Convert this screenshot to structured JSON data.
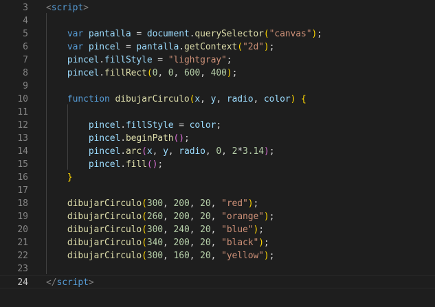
{
  "editor": {
    "line_numbers": [
      "3",
      "4",
      "5",
      "6",
      "7",
      "8",
      "9",
      "10",
      "11",
      "12",
      "13",
      "14",
      "15",
      "16",
      "17",
      "18",
      "19",
      "20",
      "21",
      "22",
      "23",
      "24"
    ],
    "active_line": "24",
    "lines": [
      {
        "segs": [
          {
            "t": "<",
            "c": "tagb"
          },
          {
            "t": "script",
            "c": "tag"
          },
          {
            "t": ">",
            "c": "tagb"
          }
        ]
      },
      {
        "segs": []
      },
      {
        "segs": [
          {
            "t": "    "
          },
          {
            "t": "var",
            "c": "kw"
          },
          {
            "t": " "
          },
          {
            "t": "pantalla",
            "c": "var"
          },
          {
            "t": " = "
          },
          {
            "t": "document",
            "c": "var"
          },
          {
            "t": "."
          },
          {
            "t": "querySelector",
            "c": "fn"
          },
          {
            "t": "(",
            "c": "p1"
          },
          {
            "t": "\"canvas\"",
            "c": "str"
          },
          {
            "t": ")",
            "c": "p1"
          },
          {
            "t": ";"
          }
        ]
      },
      {
        "segs": [
          {
            "t": "    "
          },
          {
            "t": "var",
            "c": "kw"
          },
          {
            "t": " "
          },
          {
            "t": "pincel",
            "c": "var"
          },
          {
            "t": " = "
          },
          {
            "t": "pantalla",
            "c": "var"
          },
          {
            "t": "."
          },
          {
            "t": "getContext",
            "c": "fn"
          },
          {
            "t": "(",
            "c": "p1"
          },
          {
            "t": "\"2d\"",
            "c": "str"
          },
          {
            "t": ")",
            "c": "p1"
          },
          {
            "t": ";"
          }
        ]
      },
      {
        "segs": [
          {
            "t": "    "
          },
          {
            "t": "pincel",
            "c": "var"
          },
          {
            "t": "."
          },
          {
            "t": "fillStyle",
            "c": "var"
          },
          {
            "t": " = "
          },
          {
            "t": "\"lightgray\"",
            "c": "str"
          },
          {
            "t": ";"
          }
        ]
      },
      {
        "segs": [
          {
            "t": "    "
          },
          {
            "t": "pincel",
            "c": "var"
          },
          {
            "t": "."
          },
          {
            "t": "fillRect",
            "c": "fn"
          },
          {
            "t": "(",
            "c": "p1"
          },
          {
            "t": "0",
            "c": "num"
          },
          {
            "t": ", "
          },
          {
            "t": "0",
            "c": "num"
          },
          {
            "t": ", "
          },
          {
            "t": "600",
            "c": "num"
          },
          {
            "t": ", "
          },
          {
            "t": "400",
            "c": "num"
          },
          {
            "t": ")",
            "c": "p1"
          },
          {
            "t": ";"
          }
        ]
      },
      {
        "segs": []
      },
      {
        "segs": [
          {
            "t": "    "
          },
          {
            "t": "function",
            "c": "kw"
          },
          {
            "t": " "
          },
          {
            "t": "dibujarCirculo",
            "c": "fn"
          },
          {
            "t": "(",
            "c": "p1"
          },
          {
            "t": "x",
            "c": "var"
          },
          {
            "t": ", "
          },
          {
            "t": "y",
            "c": "var"
          },
          {
            "t": ", "
          },
          {
            "t": "radio",
            "c": "var"
          },
          {
            "t": ", "
          },
          {
            "t": "color",
            "c": "var"
          },
          {
            "t": ")",
            "c": "p1"
          },
          {
            "t": " "
          },
          {
            "t": "{",
            "c": "p1"
          }
        ]
      },
      {
        "segs": []
      },
      {
        "segs": [
          {
            "t": "        "
          },
          {
            "t": "pincel",
            "c": "var"
          },
          {
            "t": "."
          },
          {
            "t": "fillStyle",
            "c": "var"
          },
          {
            "t": " = "
          },
          {
            "t": "color",
            "c": "var"
          },
          {
            "t": ";"
          }
        ]
      },
      {
        "segs": [
          {
            "t": "        "
          },
          {
            "t": "pincel",
            "c": "var"
          },
          {
            "t": "."
          },
          {
            "t": "beginPath",
            "c": "fn"
          },
          {
            "t": "()",
            "c": "p2"
          },
          {
            "t": ";"
          }
        ]
      },
      {
        "segs": [
          {
            "t": "        "
          },
          {
            "t": "pincel",
            "c": "var"
          },
          {
            "t": "."
          },
          {
            "t": "arc",
            "c": "fn"
          },
          {
            "t": "(",
            "c": "p2"
          },
          {
            "t": "x",
            "c": "var"
          },
          {
            "t": ", "
          },
          {
            "t": "y",
            "c": "var"
          },
          {
            "t": ", "
          },
          {
            "t": "radio",
            "c": "var"
          },
          {
            "t": ", "
          },
          {
            "t": "0",
            "c": "num"
          },
          {
            "t": ", "
          },
          {
            "t": "2",
            "c": "num"
          },
          {
            "t": "*"
          },
          {
            "t": "3.14",
            "c": "num"
          },
          {
            "t": ")",
            "c": "p2"
          },
          {
            "t": ";"
          }
        ]
      },
      {
        "segs": [
          {
            "t": "        "
          },
          {
            "t": "pincel",
            "c": "var"
          },
          {
            "t": "."
          },
          {
            "t": "fill",
            "c": "fn"
          },
          {
            "t": "()",
            "c": "p2"
          },
          {
            "t": ";"
          }
        ]
      },
      {
        "segs": [
          {
            "t": "    "
          },
          {
            "t": "}",
            "c": "p1"
          }
        ]
      },
      {
        "segs": []
      },
      {
        "segs": [
          {
            "t": "    "
          },
          {
            "t": "dibujarCirculo",
            "c": "fn"
          },
          {
            "t": "(",
            "c": "p1"
          },
          {
            "t": "300",
            "c": "num"
          },
          {
            "t": ", "
          },
          {
            "t": "200",
            "c": "num"
          },
          {
            "t": ", "
          },
          {
            "t": "20",
            "c": "num"
          },
          {
            "t": ", "
          },
          {
            "t": "\"red\"",
            "c": "str"
          },
          {
            "t": ")",
            "c": "p1"
          },
          {
            "t": ";"
          }
        ]
      },
      {
        "segs": [
          {
            "t": "    "
          },
          {
            "t": "dibujarCirculo",
            "c": "fn"
          },
          {
            "t": "(",
            "c": "p1"
          },
          {
            "t": "260",
            "c": "num"
          },
          {
            "t": ", "
          },
          {
            "t": "200",
            "c": "num"
          },
          {
            "t": ", "
          },
          {
            "t": "20",
            "c": "num"
          },
          {
            "t": ", "
          },
          {
            "t": "\"orange\"",
            "c": "str"
          },
          {
            "t": ")",
            "c": "p1"
          },
          {
            "t": ";"
          }
        ]
      },
      {
        "segs": [
          {
            "t": "    "
          },
          {
            "t": "dibujarCirculo",
            "c": "fn"
          },
          {
            "t": "(",
            "c": "p1"
          },
          {
            "t": "300",
            "c": "num"
          },
          {
            "t": ", "
          },
          {
            "t": "240",
            "c": "num"
          },
          {
            "t": ", "
          },
          {
            "t": "20",
            "c": "num"
          },
          {
            "t": ", "
          },
          {
            "t": "\"blue\"",
            "c": "str"
          },
          {
            "t": ")",
            "c": "p1"
          },
          {
            "t": ";"
          }
        ]
      },
      {
        "segs": [
          {
            "t": "    "
          },
          {
            "t": "dibujarCirculo",
            "c": "fn"
          },
          {
            "t": "(",
            "c": "p1"
          },
          {
            "t": "340",
            "c": "num"
          },
          {
            "t": ", "
          },
          {
            "t": "200",
            "c": "num"
          },
          {
            "t": ", "
          },
          {
            "t": "20",
            "c": "num"
          },
          {
            "t": ", "
          },
          {
            "t": "\"black\"",
            "c": "str"
          },
          {
            "t": ")",
            "c": "p1"
          },
          {
            "t": ";"
          }
        ]
      },
      {
        "segs": [
          {
            "t": "    "
          },
          {
            "t": "dibujarCirculo",
            "c": "fn"
          },
          {
            "t": "(",
            "c": "p1"
          },
          {
            "t": "300",
            "c": "num"
          },
          {
            "t": ", "
          },
          {
            "t": "160",
            "c": "num"
          },
          {
            "t": ", "
          },
          {
            "t": "20",
            "c": "num"
          },
          {
            "t": ", "
          },
          {
            "t": "\"yellow\"",
            "c": "str"
          },
          {
            "t": ")",
            "c": "p1"
          },
          {
            "t": ";"
          }
        ]
      },
      {
        "segs": []
      },
      {
        "segs": [
          {
            "t": "</",
            "c": "tagb"
          },
          {
            "t": "script",
            "c": "tag"
          },
          {
            "t": ">",
            "c": "tagb"
          }
        ]
      }
    ]
  },
  "theme": {
    "background": "#1e1e1e",
    "line_number": "#858585",
    "line_number_active": "#c6c6c6",
    "keyword": "#569cd6",
    "variable": "#9cdcfe",
    "function": "#dcdcaa",
    "string": "#ce9178",
    "number": "#b5cea8"
  }
}
